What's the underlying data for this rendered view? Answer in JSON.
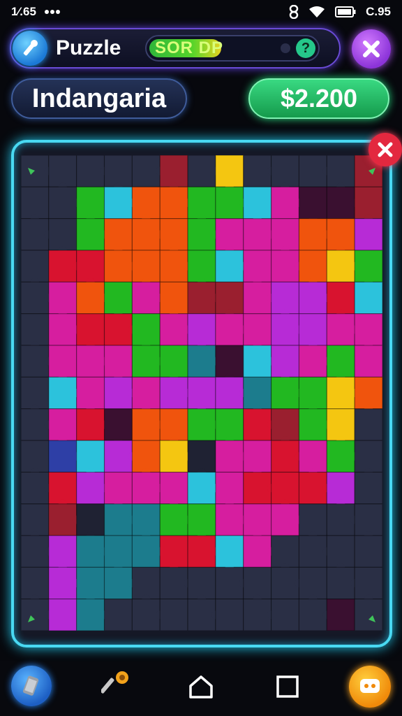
{
  "status_bar": {
    "time": "1⁄.65",
    "battery_time": "C.95"
  },
  "header": {
    "title": "Puzzle",
    "progress_label": "SOR DP",
    "progress_value": 0.42,
    "help_label": "?"
  },
  "player": {
    "name": "Indangaria",
    "balance": "$2.200"
  },
  "colors": {
    "accent_cyan": "#49d9f2",
    "accent_purple": "#b555ff",
    "money_green": "#26d57d",
    "close_red": "#e3283f"
  },
  "board": {
    "palette": {
      "R": "#d8132f",
      "O": "#f0540d",
      "Y": "#f4c611",
      "G": "#22b821",
      "C": "#2cc2dc",
      "M": "#d61e9f",
      "P": "#b72bd6",
      "B": "#2e3fa6",
      "T": "#1c7c8d",
      "E": "#2a2f45",
      "D": "#1f2233",
      "X": "#3a1030",
      "L": "#9a1f2f",
      "F": "#0f6a5a"
    },
    "rows": [
      "EEEEELEYEEEEL",
      "EEGCOOGGCMXXL",
      "EEGOOOGMMMOOP",
      "ERROOOGCMMOYG",
      "EMOGMOLLMPPRC",
      "EMRRGMPMMPPMM",
      "EMMMGGTXCPMGM",
      "ECMPMPPPTGGYO",
      "EMRXOOGGRLGYE",
      "EBCPOYDMMRMGE",
      "ERPMMMCMRRRPE",
      "ELDTTGGMMMEEE",
      "EPTTTRRCMEEEE",
      "EPTTEEEEEEEEE",
      "EPTEEEEEEEEXE"
    ]
  },
  "nav": {
    "items": [
      {
        "icon": "scroll-icon"
      },
      {
        "icon": "key-icon"
      },
      {
        "icon": "home-icon"
      },
      {
        "icon": "square-icon"
      },
      {
        "icon": "chat-icon"
      }
    ]
  }
}
